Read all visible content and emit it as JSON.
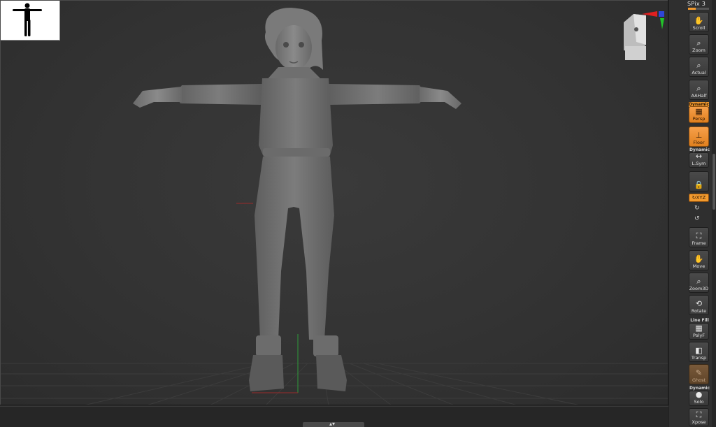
{
  "viewport": {
    "model_description": "T-pose female character sculpt: hoodie, leggings, boots",
    "thumbnail_icon": "silhouette-thumbnail-icon",
    "navigation_icon": "head-navigation-cube-icon"
  },
  "spix": {
    "label": "SPix 3",
    "value_fraction": 0.35
  },
  "shelf": {
    "scroll": {
      "label": "Scroll",
      "icon": "hand-icon"
    },
    "zoom": {
      "label": "Zoom",
      "icon": "magnifier-icon"
    },
    "actual": {
      "label": "Actual",
      "icon": "magnifier-icon"
    },
    "aahalf": {
      "label": "AAHalf",
      "icon": "magnifier-icon"
    },
    "persp_caption": "Dynamic",
    "persp": {
      "label": "Persp",
      "icon": "perspective-grid-icon",
      "active": true
    },
    "floor": {
      "label": "Floor",
      "icon": "floor-icon",
      "active": true
    },
    "lsym_caption": "Dynamic",
    "lsym": {
      "label": "L.Sym",
      "icon": "symmetry-icon"
    },
    "lock": {
      "label": "",
      "icon": "lock-icon"
    },
    "xyz": {
      "label": "↻XYZ",
      "active": true
    },
    "frame": {
      "label": "Frame",
      "icon": "frame-icon"
    },
    "move": {
      "label": "Move",
      "icon": "hand-icon"
    },
    "zoom3d": {
      "label": "Zoom3D",
      "icon": "magnifier-icon"
    },
    "rotate": {
      "label": "Rotate",
      "icon": "rotate-icon"
    },
    "polyf_caption": "Line Fill",
    "polyf": {
      "label": "PolyF",
      "icon": "polyframe-icon"
    },
    "transp": {
      "label": "Transp",
      "icon": "transparency-icon"
    },
    "ghost": {
      "label": "Ghost",
      "icon": "ghost-icon"
    },
    "solo_caption": "Dynamic",
    "solo": {
      "label": "Solo",
      "icon": "solo-icon"
    },
    "xpose": {
      "label": "Xpose",
      "icon": "xpose-icon"
    }
  },
  "colors": {
    "accent": "#f29a2e",
    "viewport_bg": "#333333",
    "shelf_bg": "#2f2f2f"
  }
}
